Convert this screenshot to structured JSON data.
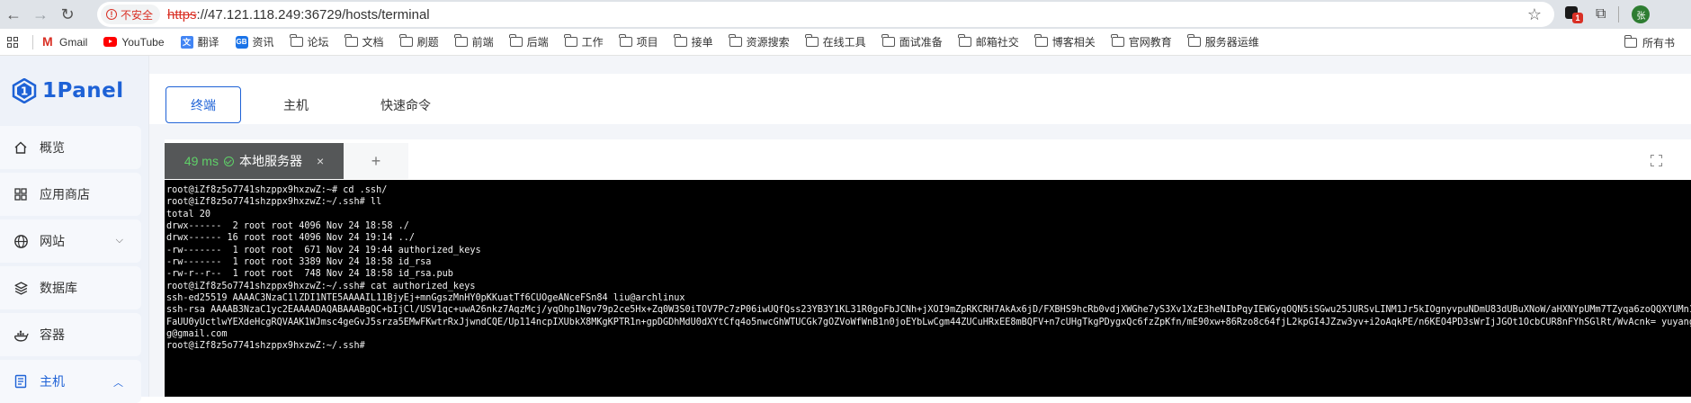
{
  "browser": {
    "nav": {
      "back": "←",
      "forward": "→",
      "reload": "↻"
    },
    "security_label": "不安全",
    "url_scheme": "https",
    "url_rest": "://47.121.118.249:36729/hosts/terminal",
    "extension_badge": "1",
    "profile_initial": "张",
    "bookmarks": [
      {
        "label": "Gmail",
        "icon": "gmail-icon"
      },
      {
        "label": "YouTube",
        "icon": "youtube-icon"
      },
      {
        "label": "翻译",
        "icon": "translate-icon"
      },
      {
        "label": "资讯",
        "icon": "gb-icon"
      },
      {
        "label": "论坛",
        "icon": "folder-icon"
      },
      {
        "label": "文档",
        "icon": "folder-icon"
      },
      {
        "label": "刷题",
        "icon": "folder-icon"
      },
      {
        "label": "前端",
        "icon": "folder-icon"
      },
      {
        "label": "后端",
        "icon": "folder-icon"
      },
      {
        "label": "工作",
        "icon": "folder-icon"
      },
      {
        "label": "项目",
        "icon": "folder-icon"
      },
      {
        "label": "接单",
        "icon": "folder-icon"
      },
      {
        "label": "资源搜索",
        "icon": "folder-icon"
      },
      {
        "label": "在线工具",
        "icon": "folder-icon"
      },
      {
        "label": "面试准备",
        "icon": "folder-icon"
      },
      {
        "label": "邮箱社交",
        "icon": "folder-icon"
      },
      {
        "label": "博客相关",
        "icon": "folder-icon"
      },
      {
        "label": "官网教育",
        "icon": "folder-icon"
      },
      {
        "label": "服务器运维",
        "icon": "folder-icon"
      }
    ],
    "all_bookmarks": "所有书"
  },
  "app": {
    "logo": "1Panel",
    "menu": [
      {
        "label": "概览",
        "icon": "home-icon"
      },
      {
        "label": "应用商店",
        "icon": "apps-icon"
      },
      {
        "label": "网站",
        "icon": "globe-icon",
        "chevron": "⌵"
      },
      {
        "label": "数据库",
        "icon": "database-icon"
      },
      {
        "label": "容器",
        "icon": "container-icon"
      },
      {
        "label": "主机",
        "icon": "host-icon",
        "chevron": "︿"
      }
    ],
    "tabs": [
      "终端",
      "主机",
      "快速命令"
    ],
    "terminal_tab": {
      "latency": "49 ms",
      "name": "本地服务器",
      "close": "×"
    },
    "add_tab": "+",
    "terminal_lines": [
      "root@iZf8z5o7741shzppx9hxzwZ:~# cd .ssh/",
      "root@iZf8z5o7741shzppx9hxzwZ:~/.ssh# ll",
      "total 20",
      "drwx------  2 root root 4096 Nov 24 18:58 ./",
      "drwx------ 16 root root 4096 Nov 24 19:14 ../",
      "-rw-------  1 root root  671 Nov 24 19:44 authorized_keys",
      "-rw-------  1 root root 3389 Nov 24 18:58 id_rsa",
      "-rw-r--r--  1 root root  748 Nov 24 18:58 id_rsa.pub",
      "root@iZf8z5o7741shzppx9hxzwZ:~/.ssh# cat authorized_keys",
      "ssh-ed25519 AAAAC3NzaC1lZDI1NTE5AAAAIL11BjyEj+mnGgszMnHY0pKKuatTf6CUOgeANceFSn84 liu@archlinux",
      "ssh-rsa AAAAB3NzaC1yc2EAAAADAQABAAABgQC+bIjCl/USV1qc+uwA26nkz7AqzMcj/yqOhp1Ngv79p2ce5Hx+Zq0W3S0iTOV7Pc7zP06iwUQfQss23YB3Y1KL31R0goFbJCNh+jXOI9mZpRKCRH7AkAx6jD/FXBHS9hcRb0vdjXWGhe7yS3Xv1XzE3heNIbPqyIEWGyqOQN5iSGwu25JURSvLINM1Jr5kIOgnyvpuNDmU83dUBuXNoW/aHXNYpUMm7TZyqa6zoQQXYUMn1LMmSy",
      "FaUU0yUctlwYEXdeHcgRQVAAK1WJmsc4geGvJ5srza5EMwFKwtrRxJjwndCQE/Up114ncpIXUbkX8MKgKPTR1n+gpDGDhMdU0dXYtCfq4o5nwcGhWTUCGk7gOZVoWfWnB1n0joEYbLwCgm44ZUCuHRxEE8mBQFV+n7cUHgTkgPDygxQc6fzZpKfn/mE90xw+86Rzo8c64fjL2kpGI4JZzw3yv+i2oAqkPE/n6KEO4PD3sWrIjJGOt1OcbCUR8nFYhSGlRt/WvAcnk= yuyangcodin",
      "g@gmail.com",
      "root@iZf8z5o7741shzppx9hxzwZ:~/.ssh# "
    ]
  }
}
